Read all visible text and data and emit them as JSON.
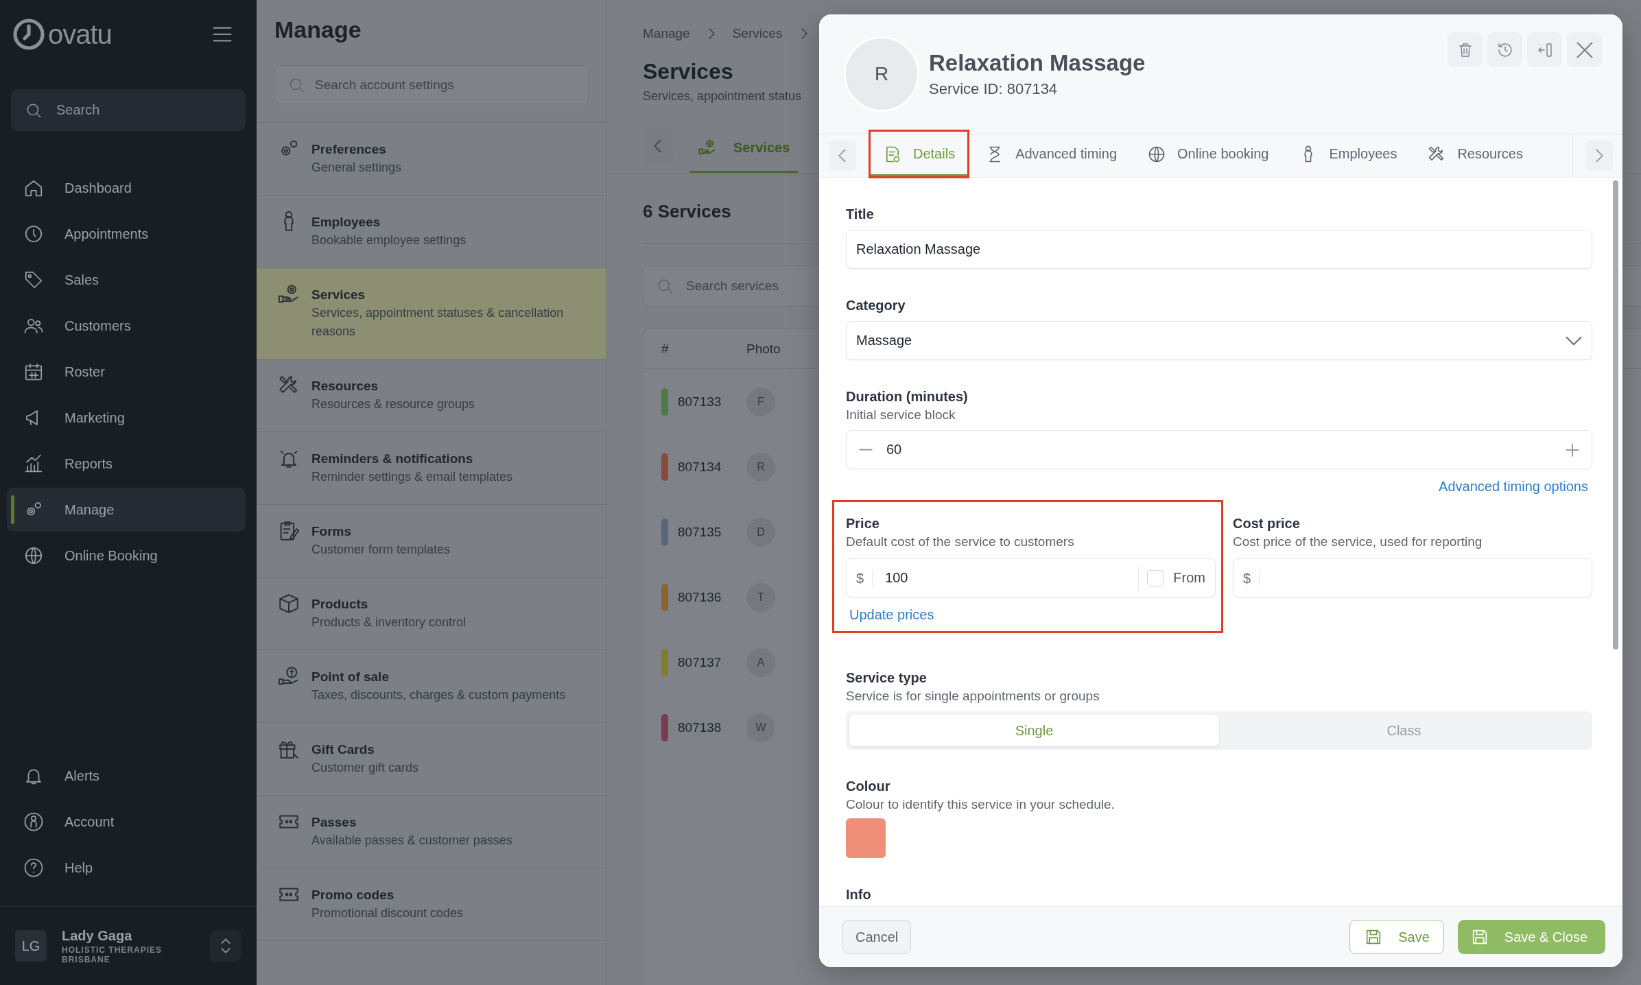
{
  "sidebar": {
    "logo": "ovatu",
    "search": {
      "placeholder": "Search"
    },
    "items": [
      {
        "label": "Dashboard",
        "selected": false
      },
      {
        "label": "Appointments",
        "selected": false
      },
      {
        "label": "Sales",
        "selected": false
      },
      {
        "label": "Customers",
        "selected": false
      },
      {
        "label": "Roster",
        "selected": false
      },
      {
        "label": "Marketing",
        "selected": false
      },
      {
        "label": "Reports",
        "selected": false
      },
      {
        "label": "Manage",
        "selected": true
      },
      {
        "label": "Online Booking",
        "selected": false
      }
    ],
    "bottom_items": [
      {
        "label": "Alerts"
      },
      {
        "label": "Account"
      },
      {
        "label": "Help"
      }
    ],
    "user": {
      "initials": "LG",
      "name": "Lady Gaga",
      "business": "HOLISTIC THERAPIES BRISBANE"
    }
  },
  "manage": {
    "title": "Manage",
    "search": {
      "placeholder": "Search account settings"
    },
    "items": [
      {
        "title": "Preferences",
        "subtitle": "General settings",
        "selected": false
      },
      {
        "title": "Employees",
        "subtitle": "Bookable employee settings",
        "selected": false
      },
      {
        "title": "Services",
        "subtitle": "Services, appointment statuses & cancellation reasons",
        "selected": true
      },
      {
        "title": "Resources",
        "subtitle": "Resources & resource groups",
        "selected": false
      },
      {
        "title": "Reminders & notifications",
        "subtitle": "Reminder settings & email templates",
        "selected": false
      },
      {
        "title": "Forms",
        "subtitle": "Customer form templates",
        "selected": false
      },
      {
        "title": "Products",
        "subtitle": "Products & inventory control",
        "selected": false
      },
      {
        "title": "Point of sale",
        "subtitle": "Taxes, discounts, charges & custom payments",
        "selected": false
      },
      {
        "title": "Gift Cards",
        "subtitle": "Customer gift cards",
        "selected": false
      },
      {
        "title": "Passes",
        "subtitle": "Available passes & customer passes",
        "selected": false
      },
      {
        "title": "Promo codes",
        "subtitle": "Promotional discount codes",
        "selected": false
      }
    ]
  },
  "services": {
    "breadcrumb": [
      "Manage",
      "Services"
    ],
    "title": "Services",
    "subtitle": "Services, appointment status",
    "tabs": [
      {
        "label": "Services",
        "selected": true
      }
    ],
    "count": "6 Services",
    "search": {
      "placeholder": "Search services"
    },
    "columns": [
      "#",
      "Photo"
    ],
    "rows": [
      {
        "id": "807133",
        "photo": "F",
        "color": "#4e7a48"
      },
      {
        "id": "807134",
        "photo": "R",
        "color": "#8a4a3a"
      },
      {
        "id": "807135",
        "photo": "D",
        "color": "#5a6678"
      },
      {
        "id": "807136",
        "photo": "T",
        "color": "#8a6530"
      },
      {
        "id": "807137",
        "photo": "A",
        "color": "#857b2e"
      },
      {
        "id": "807138",
        "photo": "W",
        "color": "#7a3a50"
      }
    ]
  },
  "modal": {
    "avatar": "R",
    "title": "Relaxation Massage",
    "subtitle": "Service ID: 807134",
    "tabs": [
      {
        "label": "Details",
        "selected": true,
        "highlighted": true
      },
      {
        "label": "Advanced timing",
        "selected": false,
        "highlighted": false
      },
      {
        "label": "Online booking",
        "selected": false,
        "highlighted": false
      },
      {
        "label": "Employees",
        "selected": false,
        "highlighted": false
      },
      {
        "label": "Resources",
        "selected": false,
        "highlighted": false
      }
    ],
    "title_field": {
      "label": "Title",
      "value": "Relaxation Massage"
    },
    "category_field": {
      "label": "Category",
      "value": "Massage"
    },
    "duration_field": {
      "label": "Duration (minutes)",
      "hint": "Initial service block",
      "value": "60"
    },
    "advanced_link": "Advanced timing options",
    "price": {
      "label": "Price",
      "hint": "Default cost of the service to customers",
      "currency": "$",
      "value": "100",
      "from": {
        "label": "From",
        "checked": false
      },
      "link": "Update prices",
      "highlighted": true
    },
    "cost_price": {
      "label": "Cost price",
      "hint": "Cost price of the service, used for reporting",
      "currency": "$"
    },
    "service_type": {
      "label": "Service type",
      "hint": "Service is for single appointments or groups",
      "options": [
        {
          "label": "Single",
          "selected": true
        },
        {
          "label": "Class",
          "selected": false
        }
      ]
    },
    "colour": {
      "label": "Colour",
      "hint": "Colour to identify this service in your schedule.",
      "color": "#ef8f7a"
    },
    "info": {
      "label": "Info"
    },
    "footer": {
      "cancel": "Cancel",
      "save": "Save",
      "save_close": "Save & Close"
    }
  }
}
